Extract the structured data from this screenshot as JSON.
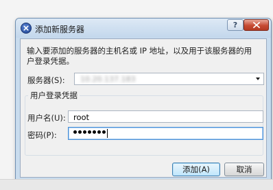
{
  "dialog": {
    "title": "添加新服务器",
    "help_label": "?",
    "instructions": "输入要添加的服务器的主机名或 IP 地址，以及用于该服务器的用户登录凭据。",
    "server_label": "服务器(S):",
    "server_value": "10.20.137.183",
    "credentials_group_title": "用户登录凭据",
    "username_label": "用户名(U):",
    "username_value": "root",
    "password_label": "密码(P):",
    "password_mask": "•••••••",
    "add_button_label": "添加(A)",
    "cancel_button_label": "取消"
  },
  "colors": {
    "titlebar": "#c9dcee",
    "close_button": "#c74a33",
    "focus_border": "#4a90d8",
    "default_button": "#bee6fd"
  },
  "icons": {
    "app": "server-add-icon",
    "help": "help-icon",
    "close": "close-icon",
    "dropdown": "chevron-down-icon"
  }
}
